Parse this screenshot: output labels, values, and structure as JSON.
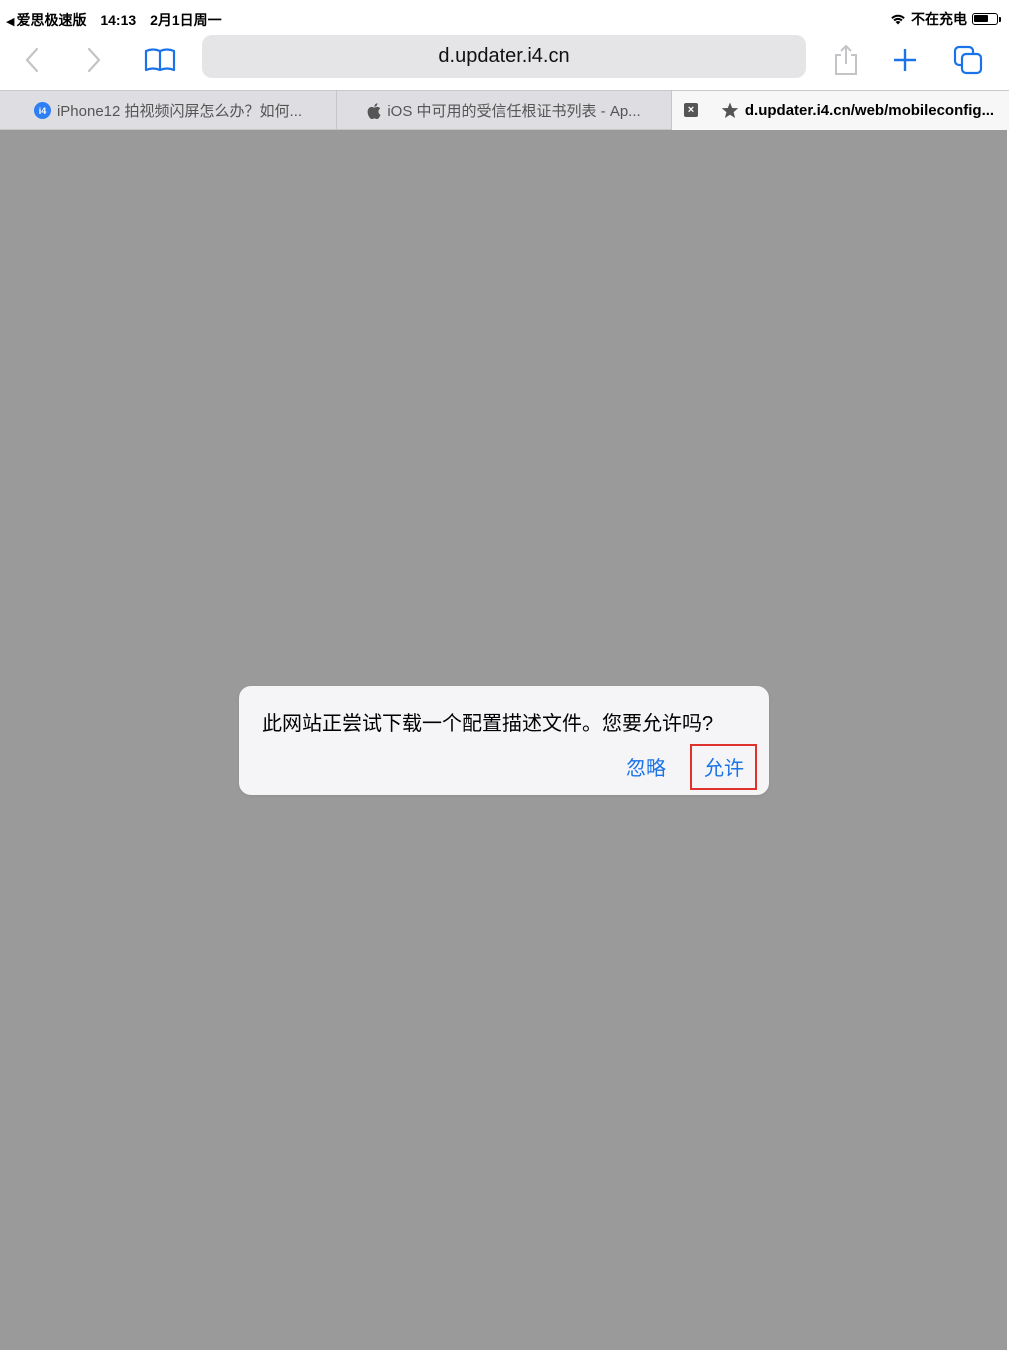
{
  "status_bar": {
    "back_app": "爱思极速版",
    "time": "14:13",
    "date": "2月1日周一",
    "charging_status": "不在充电",
    "battery_level": 0.65
  },
  "toolbar": {
    "address": "d.updater.i4.cn",
    "icons": [
      "back-icon",
      "forward-icon",
      "bookmarks-icon",
      "share-icon",
      "new-tab-icon",
      "tabs-icon"
    ]
  },
  "tabs": [
    {
      "title": "iPhone12 拍视频闪屏怎么办？如何...",
      "favicon": "i4-favicon-icon",
      "favicon_text": "i4",
      "active": false
    },
    {
      "title": "iOS 中可用的受信任根证书列表 - Ap...",
      "favicon": "apple-icon",
      "active": false
    },
    {
      "title": "d.updater.i4.cn/web/mobileconfig...",
      "favicon": "star-icon",
      "active": true
    }
  ],
  "dialog": {
    "message": "此网站正尝试下载一个配置描述文件。您要允许吗?",
    "ignore_label": "忽略",
    "allow_label": "允许"
  },
  "colors": {
    "accent": "#1a73e8",
    "overlay": "#9a9a9a",
    "highlight": "#e0312c"
  }
}
